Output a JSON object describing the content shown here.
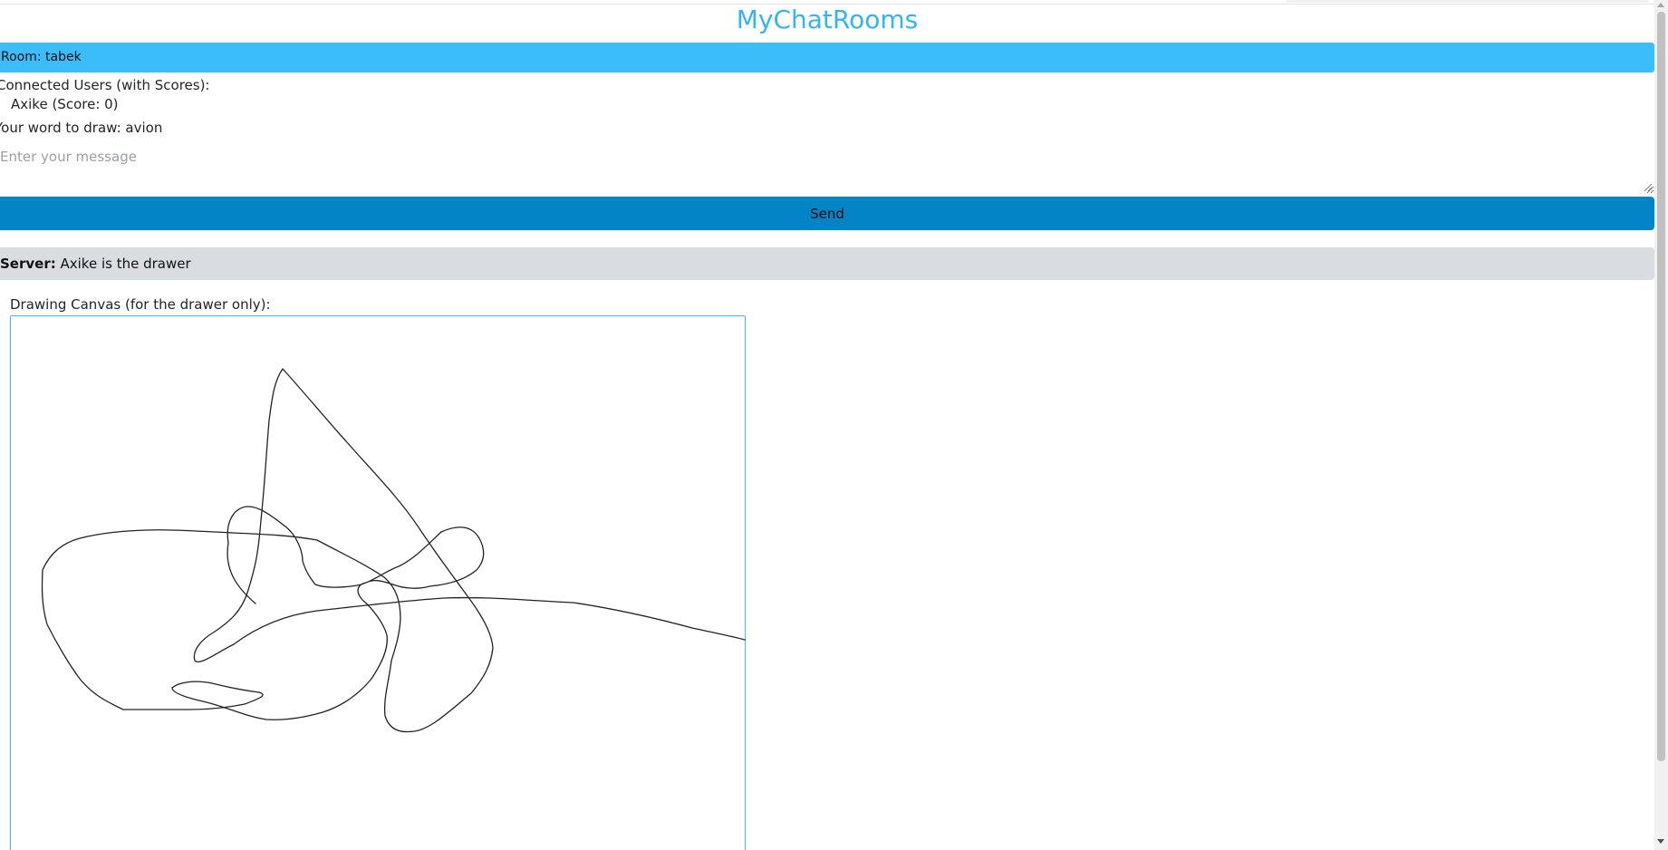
{
  "app": {
    "title": "MyChatRooms"
  },
  "room": {
    "label": "Room: tabek"
  },
  "users": {
    "heading": "Connected Users (with Scores):",
    "items": [
      "Axike (Score: 0)"
    ]
  },
  "word": {
    "text": "Your word to draw: avion"
  },
  "composer": {
    "placeholder": "Enter your message",
    "value": "",
    "send_label": "Send"
  },
  "messages": [
    {
      "sender": "Server:",
      "text": " Axike is the drawer"
    }
  ],
  "canvas": {
    "label": "Drawing Canvas (for the drawer only):"
  },
  "colors": {
    "accent": "#3bbdf9",
    "title": "#33b5f0",
    "send_button": "#0284c7",
    "message_bg": "#d9dde1",
    "stroke": "#222222"
  }
}
